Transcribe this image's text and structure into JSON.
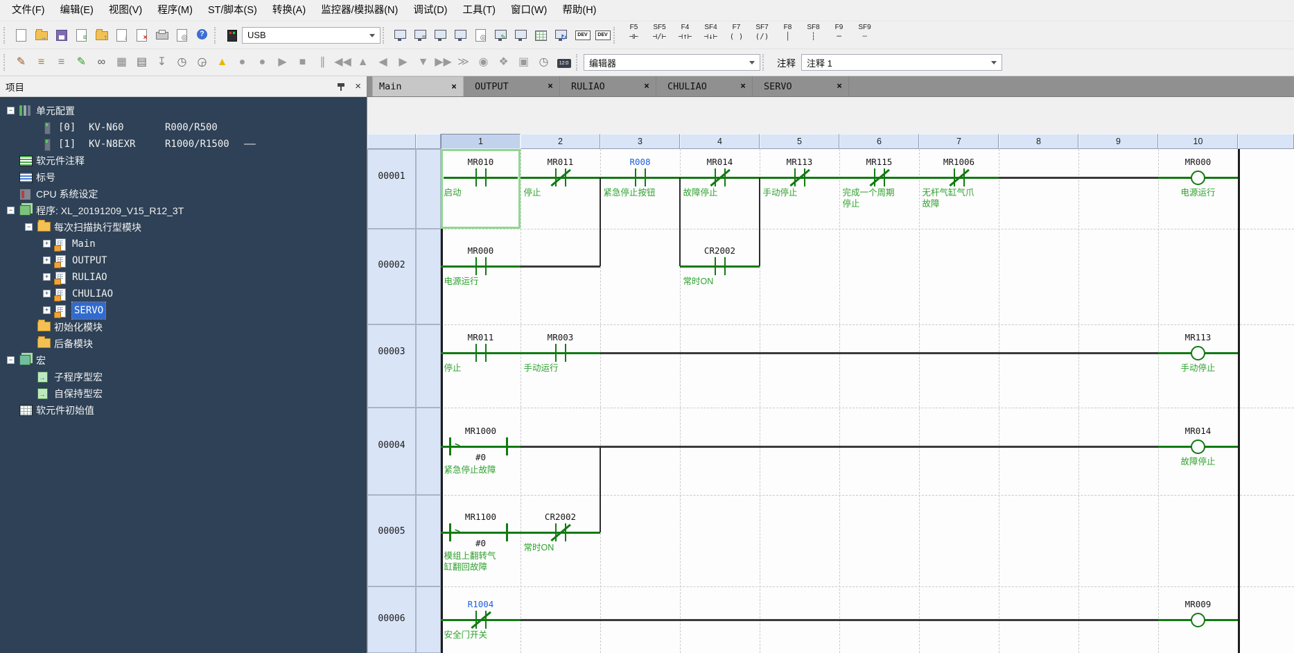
{
  "menu_bar": {
    "items": [
      "文件(F)",
      "编辑(E)",
      "视图(V)",
      "程序(M)",
      "ST/脚本(S)",
      "转换(A)",
      "监控器/模拟器(N)",
      "调试(D)",
      "工具(T)",
      "窗口(W)",
      "帮助(H)"
    ]
  },
  "toolbar_main": {
    "usb_value": "USB",
    "icons_file": [
      {
        "name": "new-file-icon",
        "base": "page"
      },
      {
        "name": "open-project-icon",
        "base": "folder",
        "overlay": "→",
        "ocolor": "#1d62d6"
      },
      {
        "name": "save-project-icon",
        "base": "floppy"
      },
      {
        "name": "device-register-icon",
        "base": "page",
        "overlay": "≡",
        "ocolor": "#3a8a3a"
      },
      {
        "name": "load-from-plc-icon",
        "base": "folder",
        "overlay": "↑",
        "ocolor": "#1d62d6"
      },
      {
        "name": "save-to-plc-icon",
        "base": "page",
        "overlay": "↓",
        "ocolor": "#c07a10"
      },
      {
        "name": "close-file-icon",
        "base": "page",
        "overlay": "×",
        "ocolor": "#cc2222"
      },
      {
        "name": "print-icon",
        "base": "printer"
      },
      {
        "name": "print-preview-icon",
        "base": "page",
        "overlay": "◎",
        "ocolor": "#555"
      },
      {
        "name": "help-icon",
        "base": "helpc",
        "glyph": "?"
      }
    ],
    "comm_device_icon": {
      "name": "usb-device-icon",
      "base": "devbox"
    },
    "icons_transfer": [
      {
        "name": "comm-settings-icon",
        "base": "monitor",
        "overlay": "→",
        "ocolor": "#1d62d6"
      },
      {
        "name": "pc-program-icon",
        "base": "monitor",
        "overlay": "≡",
        "ocolor": "#555"
      },
      {
        "name": "write-to-plc-icon",
        "base": "monitor",
        "overlay": "→",
        "ocolor": "#2f9c2f"
      },
      {
        "name": "read-from-plc-icon",
        "base": "monitor",
        "overlay": "←",
        "ocolor": "#1d62d6"
      },
      {
        "name": "monitor-search-icon",
        "base": "page",
        "overlay": "◎",
        "ocolor": "#555"
      },
      {
        "name": "simulator-edit-icon",
        "base": "monitor",
        "overlay": "✎",
        "ocolor": "#2f9c2f"
      },
      {
        "name": "simulator-icon",
        "base": "monitor"
      },
      {
        "name": "device-table-icon",
        "base": "tablei"
      },
      {
        "name": "pc-sync-icon",
        "base": "monitor",
        "overlay": "↻",
        "ocolor": "#1d62d6"
      },
      {
        "name": "dev-monitor-icon",
        "base": "badge",
        "glyph": "DEV"
      },
      {
        "name": "dev-monitor-alt-icon",
        "base": "badge",
        "glyph": "DEV"
      }
    ],
    "fkeys": [
      {
        "label": "F5",
        "glyph": "⊣⊢"
      },
      {
        "label": "SF5",
        "glyph": "⊣/⊢"
      },
      {
        "label": "F4",
        "glyph": "⊣↑⊢"
      },
      {
        "label": "SF4",
        "glyph": "⊣↓⊢"
      },
      {
        "label": "F7",
        "glyph": "( )"
      },
      {
        "label": "SF7",
        "glyph": "(/)"
      },
      {
        "label": "F8",
        "glyph": "│"
      },
      {
        "label": "SF8",
        "glyph": "┆"
      },
      {
        "label": "F9",
        "glyph": "─"
      },
      {
        "label": "SF9",
        "glyph": "┄"
      }
    ]
  },
  "toolbar_edit": {
    "editor_value": "编辑器",
    "comment_label": "注释",
    "comment_value": "注释 1",
    "icons_edit": [
      {
        "name": "ladder-edit-icon",
        "glyph": "✎",
        "color": "#9a5a2a"
      },
      {
        "name": "device-comment-list-icon",
        "glyph": "≡",
        "color": "#c07a10"
      },
      {
        "name": "label-list-icon",
        "glyph": "≡",
        "color": "#888"
      },
      {
        "name": "script-edit-icon",
        "glyph": "✎",
        "color": "#2f9c2f"
      },
      {
        "name": "view-glasses-icon",
        "glyph": "∞",
        "color": "#555"
      },
      {
        "name": "window-grid-icon",
        "glyph": "▦",
        "color": "#888"
      },
      {
        "name": "usage-list-icon",
        "glyph": "▤",
        "color": "#666"
      },
      {
        "name": "drag-tool-icon",
        "glyph": "↧",
        "color": "#888"
      },
      {
        "name": "pc-timing-icon",
        "glyph": "◷",
        "color": "#666"
      },
      {
        "name": "doc-timing-icon",
        "glyph": "◶",
        "color": "#666"
      },
      {
        "name": "pc-warning-icon",
        "glyph": "▲",
        "color": "#e8b800"
      }
    ],
    "icons_playback": [
      {
        "name": "record-icon",
        "glyph": "●",
        "color": "#9a9a9a"
      },
      {
        "name": "record-alt-icon",
        "glyph": "●",
        "color": "#9a9a9a"
      },
      {
        "name": "play-icon",
        "glyph": "▶",
        "color": "#9a9a9a"
      },
      {
        "name": "stop-icon",
        "glyph": "■",
        "color": "#9a9a9a"
      },
      {
        "name": "pause-icon",
        "glyph": "∥",
        "color": "#9a9a9a"
      },
      {
        "name": "skip-to-start-icon",
        "glyph": "◀◀",
        "color": "#9a9a9a"
      },
      {
        "name": "step-up-icon",
        "glyph": "▲",
        "color": "#9a9a9a"
      },
      {
        "name": "step-back-icon",
        "glyph": "◀",
        "color": "#9a9a9a"
      },
      {
        "name": "step-forward-icon",
        "glyph": "▶",
        "color": "#9a9a9a"
      },
      {
        "name": "step-down-icon",
        "glyph": "▼",
        "color": "#9a9a9a"
      },
      {
        "name": "skip-to-end-icon",
        "glyph": "▶▶",
        "color": "#9a9a9a"
      },
      {
        "name": "advance-icon",
        "glyph": "≫",
        "color": "#9a9a9a"
      },
      {
        "name": "record-down-icon",
        "glyph": "◉",
        "color": "#9a9a9a"
      },
      {
        "name": "pause-hand-icon",
        "glyph": "❖",
        "color": "#9a9a9a"
      },
      {
        "name": "monitor-pause-icon",
        "glyph": "▣",
        "color": "#9a9a9a"
      },
      {
        "name": "stopwatch-icon",
        "glyph": "◷",
        "color": "#777"
      },
      {
        "name": "time-chart-icon",
        "glyph": "12:0",
        "badge": true
      }
    ]
  },
  "project_panel": {
    "title": "项目",
    "tree": [
      {
        "label": "单元配置",
        "icon": "unit",
        "level": 0,
        "expander": "minus"
      },
      {
        "parts": {
          "idx": "[0]",
          "name": "KV-N60",
          "range": "R000/R500"
        },
        "icon": "module",
        "level": "dev"
      },
      {
        "parts": {
          "idx": "[1]",
          "name": "KV-N8EXR",
          "range": "R1000/R1500",
          "tail": "——"
        },
        "icon": "module",
        "level": "dev"
      },
      {
        "label": "软元件注释",
        "icon": "tableg",
        "level": 0
      },
      {
        "label": "标号",
        "icon": "tableb",
        "level": 0
      },
      {
        "label": "CPU 系统设定",
        "icon": "cpu",
        "level": 0
      },
      {
        "label": "程序: XL_20191209_V15_R12_3T",
        "icon": "prog",
        "level": 0,
        "expander": "minus"
      },
      {
        "label": "每次扫描执行型模块",
        "icon": "folder",
        "level": 1,
        "expander": "minus"
      },
      {
        "label": "Main",
        "icon": "ladder",
        "level": 2,
        "expander": "plus",
        "mono": true
      },
      {
        "label": "OUTPUT",
        "icon": "ladder",
        "level": 2,
        "expander": "plus",
        "mono": true
      },
      {
        "label": "RULIAO",
        "icon": "ladder",
        "level": 2,
        "expander": "plus",
        "mono": true
      },
      {
        "label": "CHULIAO",
        "icon": "ladder",
        "level": 2,
        "expander": "plus",
        "mono": true
      },
      {
        "label": "SERVO",
        "icon": "ladder",
        "level": 2,
        "expander": "plus",
        "mono": true,
        "selected": true
      },
      {
        "label": "初始化模块",
        "icon": "folder",
        "level": 1
      },
      {
        "label": "后备模块",
        "icon": "folder",
        "level": 1
      },
      {
        "label": "宏",
        "icon": "macro",
        "level": 0,
        "expander": "minus"
      },
      {
        "label": "子程序型宏",
        "icon": "msub",
        "level": 1
      },
      {
        "label": "自保持型宏",
        "icon": "msub",
        "level": 1
      },
      {
        "label": "软元件初始值",
        "icon": "init",
        "level": 0
      }
    ]
  },
  "tabs": [
    {
      "label": "Main",
      "active": true
    },
    {
      "label": "OUTPUT",
      "active": false
    },
    {
      "label": "RULIAO",
      "active": false
    },
    {
      "label": "CHULIAO",
      "active": false
    },
    {
      "label": "SERVO",
      "active": false
    }
  ],
  "ladder": {
    "column_headers": [
      "1",
      "2",
      "3",
      "4",
      "5",
      "6",
      "7",
      "8",
      "9",
      "10"
    ],
    "colors": {
      "wire_green": "#117a11",
      "wire_black": "#3a3a3a",
      "comment": "#2da12d",
      "device": "#161616",
      "device_blue": "#1f5fe0",
      "selection": "#8fd88f"
    },
    "rungs": [
      {
        "number": "00001",
        "contacts": [
          {
            "col": 1,
            "device": "MR010",
            "type": "no",
            "comment": "启动"
          },
          {
            "col": 2,
            "device": "MR011",
            "type": "nc",
            "comment": "停止"
          },
          {
            "col": 3,
            "device": "R008",
            "type": "no",
            "comment": "紧急停止按钮",
            "blue": true
          },
          {
            "col": 4,
            "device": "MR014",
            "type": "nc",
            "comment": "故障停止"
          },
          {
            "col": 5,
            "device": "MR113",
            "type": "nc",
            "comment": "手动停止"
          },
          {
            "col": 6,
            "device": "MR115",
            "type": "nc",
            "comment": "完成一个周期\n停止"
          },
          {
            "col": 7,
            "device": "MR1006",
            "type": "nc",
            "comment": "无杆气缸气爪\n故障"
          }
        ],
        "coil": {
          "device": "MR000",
          "comment": "电源运行"
        }
      },
      {
        "number": "00002",
        "contacts": [
          {
            "col": 1,
            "device": "MR000",
            "type": "no",
            "comment": "电源运行"
          },
          {
            "col": 4,
            "device": "CR2002",
            "type": "no",
            "comment": "常时ON"
          }
        ]
      },
      {
        "number": "00003",
        "contacts": [
          {
            "col": 1,
            "device": "MR011",
            "type": "no",
            "comment": "停止"
          },
          {
            "col": 2,
            "device": "MR003",
            "type": "no",
            "comment": "手动运行"
          }
        ],
        "coil": {
          "device": "MR113",
          "comment": "手动停止"
        }
      },
      {
        "number": "00004",
        "contacts": [
          {
            "col": 1,
            "device": "MR1000",
            "type": "cmp",
            "operator": ">",
            "operand": "#0",
            "comment": "紧急停止故障"
          }
        ],
        "coil": {
          "device": "MR014",
          "comment": "故障停止"
        }
      },
      {
        "number": "00005",
        "contacts": [
          {
            "col": 1,
            "device": "MR1100",
            "type": "cmp",
            "operator": ">",
            "operand": "#0",
            "comment": "模组上翻转气\n缸翻回故障"
          },
          {
            "col": 2,
            "device": "CR2002",
            "type": "nc",
            "comment": "常时ON"
          }
        ]
      },
      {
        "number": "00006",
        "contacts": [
          {
            "col": 1,
            "device": "R1004",
            "type": "nc",
            "comment": "安全门开关",
            "blue": true
          }
        ],
        "coil": {
          "device": "MR009"
        }
      }
    ]
  }
}
